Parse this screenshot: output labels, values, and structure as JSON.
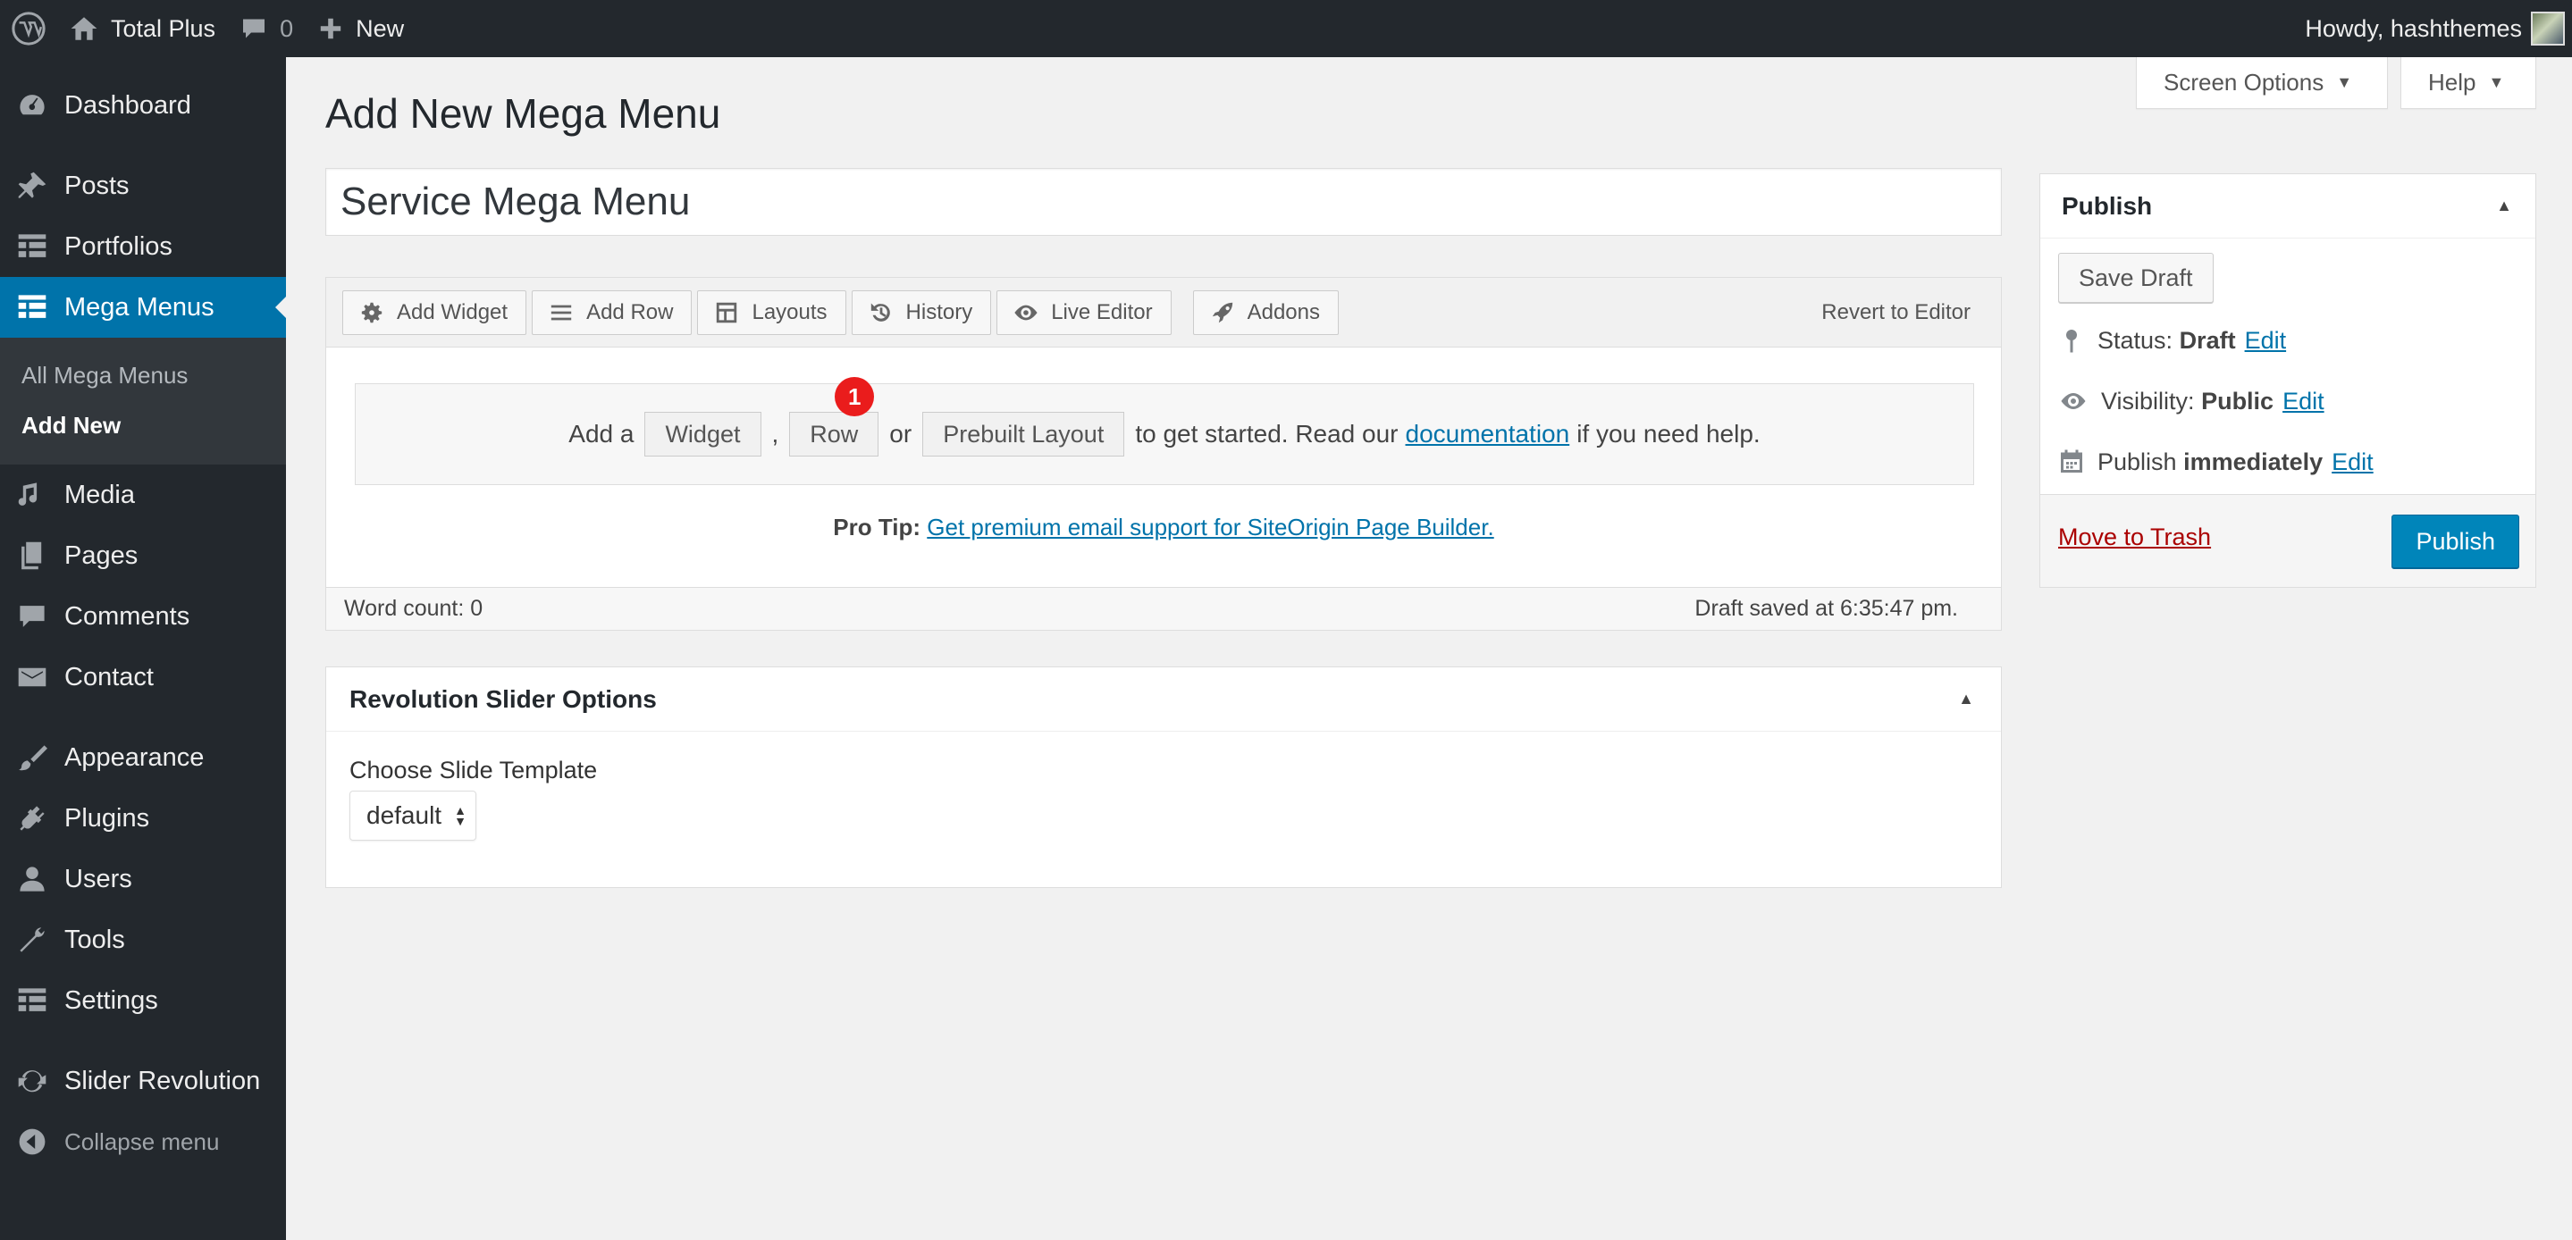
{
  "adminbar": {
    "site_name": "Total Plus",
    "comments_count": "0",
    "new_label": "New",
    "howdy": "Howdy, hashthemes"
  },
  "sidebar": {
    "items": [
      {
        "label": "Dashboard",
        "icon": "dashboard-icon"
      },
      {
        "label": "Posts",
        "icon": "pin-icon"
      },
      {
        "label": "Portfolios",
        "icon": "grid-icon"
      },
      {
        "label": "Mega Menus",
        "icon": "grid-icon"
      },
      {
        "label": "Media",
        "icon": "media-icon"
      },
      {
        "label": "Pages",
        "icon": "pages-icon"
      },
      {
        "label": "Comments",
        "icon": "comment-icon"
      },
      {
        "label": "Contact",
        "icon": "mail-icon"
      },
      {
        "label": "Appearance",
        "icon": "brush-icon"
      },
      {
        "label": "Plugins",
        "icon": "plug-icon"
      },
      {
        "label": "Users",
        "icon": "user-icon"
      },
      {
        "label": "Tools",
        "icon": "wrench-icon"
      },
      {
        "label": "Settings",
        "icon": "settings-icon"
      },
      {
        "label": "Slider Revolution",
        "icon": "refresh-icon"
      }
    ],
    "submenu": [
      "All Mega Menus",
      "Add New"
    ],
    "collapse": "Collapse menu"
  },
  "tabs": {
    "screen_options": "Screen Options",
    "help": "Help"
  },
  "page": {
    "title": "Add New Mega Menu",
    "post_title_value": "Service Mega Menu"
  },
  "builder": {
    "toolbar": [
      "Add Widget",
      "Add Row",
      "Layouts",
      "History",
      "Live Editor",
      "Addons"
    ],
    "revert": "Revert to Editor",
    "welcome": {
      "add_a": "Add a",
      "widget": "Widget",
      "comma": ",",
      "row": "Row",
      "or": "or",
      "prebuilt": "Prebuilt Layout",
      "text1": "to get started. Read our",
      "doc_link": "documentation",
      "text2": "if you need help.",
      "badge": "1"
    },
    "protip_label": "Pro Tip:",
    "protip_link": "Get premium email support for SiteOrigin Page Builder.",
    "word_count": "Word count: 0",
    "draft_saved": "Draft saved at 6:35:47 pm."
  },
  "revslider": {
    "title": "Revolution Slider Options",
    "label": "Choose Slide Template",
    "selected": "default"
  },
  "publish": {
    "title": "Publish",
    "save_draft": "Save Draft",
    "status_label": "Status:",
    "status_value": "Draft",
    "visibility_label": "Visibility:",
    "visibility_value": "Public",
    "publish_label": "Publish",
    "publish_value": "immediately",
    "edit": "Edit",
    "trash": "Move to Trash",
    "publish_button": "Publish"
  }
}
